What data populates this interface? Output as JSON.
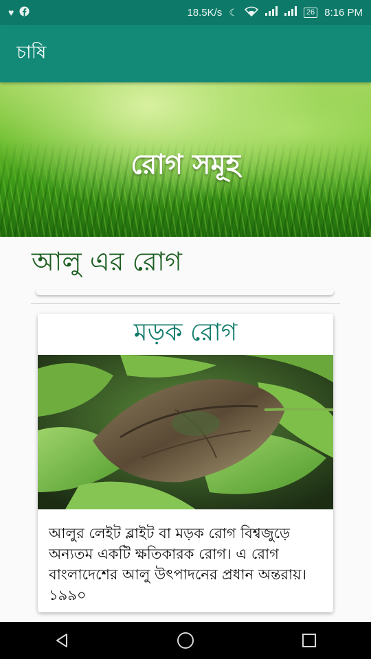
{
  "status_bar": {
    "net_speed": "18.5K/s",
    "battery": "26",
    "time": "8:16 PM"
  },
  "toolbar": {
    "title": "চাষি"
  },
  "hero": {
    "heading": "রোগ সমূহ"
  },
  "section": {
    "title": "আলু এর রোগ"
  },
  "card": {
    "title": "মড়ক রোগ",
    "description": "আলুর লেইট ব্লাইট বা মড়ক রোগ বিশ্বজুড়ে অন্যতম একটি ক্ষতিকারক রোগ। এ রোগ বাংলাদেশের আলু উৎপাদনের প্রধান অন্তরায়। ১৯৯০"
  },
  "icons": {
    "status_left": [
      "heart-pulse-icon",
      "facebook-icon"
    ],
    "status_right": [
      "moon-icon",
      "wifi-icon",
      "signal-icon",
      "signal-icon",
      "battery-icon"
    ],
    "nav": [
      "back-icon",
      "home-icon",
      "recents-icon"
    ]
  },
  "colors": {
    "toolbar": "#138a78",
    "status_bar": "#0d7a69",
    "card_title": "#0d7a69",
    "section_title": "#1b5e20"
  }
}
